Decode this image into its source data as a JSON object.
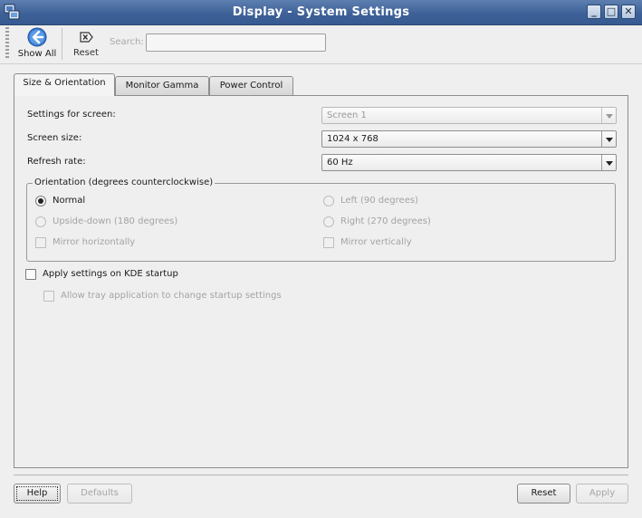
{
  "window": {
    "title": "Display - System Settings",
    "controls": {
      "minimize": "_",
      "maximize": "□",
      "close": "✕"
    }
  },
  "toolbar": {
    "show_all_label": "Show All",
    "reset_label": "Reset",
    "search_label": "Search:",
    "search_value": ""
  },
  "tabs": [
    {
      "label": "Size & Orientation",
      "active": true
    },
    {
      "label": "Monitor Gamma",
      "active": false
    },
    {
      "label": "Power Control",
      "active": false
    }
  ],
  "size_orientation": {
    "screen_label": "Settings for screen:",
    "screen_value": "Screen 1",
    "size_label": "Screen size:",
    "size_value": "1024 x 768",
    "refresh_label": "Refresh rate:",
    "refresh_value": "60 Hz",
    "orientation_title": "Orientation (degrees counterclockwise)",
    "orientation": {
      "normal": "Normal",
      "left": "Left (90 degrees)",
      "upside_down": "Upside-down (180 degrees)",
      "right": "Right (270 degrees)",
      "mirror_h": "Mirror horizontally",
      "mirror_v": "Mirror vertically",
      "selected": "normal"
    },
    "apply_startup_label": "Apply settings on KDE startup",
    "apply_startup_checked": false,
    "allow_tray_label": "Allow tray application to change startup settings",
    "allow_tray_checked": false
  },
  "footer": {
    "help_label": "Help",
    "defaults_label": "Defaults",
    "reset_label": "Reset",
    "apply_label": "Apply"
  },
  "colors": {
    "titlebar": "#3e6198",
    "background": "#efefef",
    "disabled_text": "#a3a3a3"
  }
}
